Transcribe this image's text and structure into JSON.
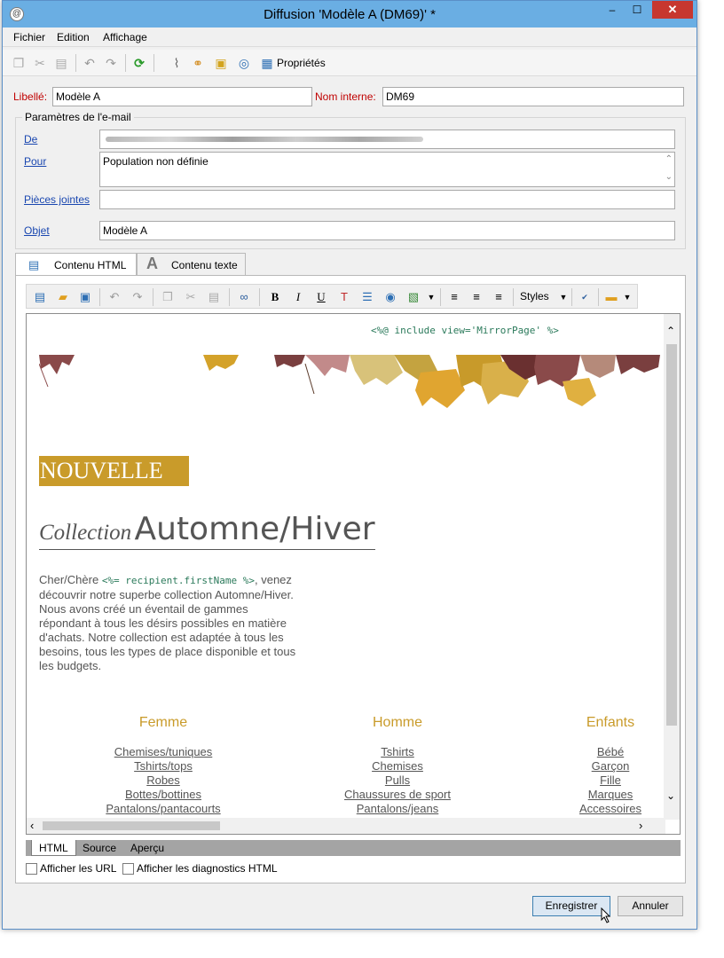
{
  "window": {
    "title": "Diffusion 'Modèle A (DM69)' *",
    "minimize": "–",
    "maximize": "☐",
    "close": "✕"
  },
  "menu": {
    "items": [
      "Fichier",
      "Edition",
      "Affichage"
    ]
  },
  "toolbar": {
    "properties_label": "Propriétés"
  },
  "form": {
    "label_label": "Libellé:",
    "label_value": "Modèle A",
    "internal_name_label": "Nom interne:",
    "internal_name_value": "DM69"
  },
  "email_params": {
    "group_title": "Paramètres de l'e-mail",
    "from_label": "De",
    "to_label": "Pour",
    "to_value": "Population non définie",
    "attachments_label": "Pièces jointes",
    "attachments_value": "",
    "subject_label": "Objet",
    "subject_value": "Modèle A"
  },
  "tabs": {
    "html": "Contenu HTML",
    "text": "Contenu texte"
  },
  "editor_toolbar": {
    "bold": "B",
    "italic": "I",
    "underline": "U",
    "styles": "Styles"
  },
  "content": {
    "include": "<%@ include view='MirrorPage' %>",
    "nouvelle": "NOUVELLE",
    "collection_a": "Collection",
    "collection_b": "Automne/Hiver",
    "greeting": "Cher/Chère ",
    "first_name_var": "<%= recipient.firstName %>",
    "body_after_var": ", venez découvrir notre superbe collection Automne/Hiver.",
    "body_2": "Nous avons créé un éventail de gammes répondant à tous les désirs possibles en matière d'achats. Notre collection est adaptée à tous les besoins, tous les types de place disponible et tous les budgets.",
    "columns": [
      {
        "title": "Femme",
        "items": [
          "Chemises/tuniques",
          "Tshirts/tops",
          "Robes",
          "Bottes/bottines",
          "Pantalons/pantacourts"
        ]
      },
      {
        "title": "Homme",
        "items": [
          "Tshirts",
          "Chemises",
          "Pulls",
          "Chaussures de sport",
          "Pantalons/jeans"
        ]
      },
      {
        "title": "Enfants",
        "items": [
          "Bébé",
          "Garçon",
          "Fille",
          "Marques",
          "Accessoires"
        ]
      }
    ]
  },
  "view_tabs": [
    "HTML",
    "Source",
    "Aperçu"
  ],
  "options": {
    "show_urls": "Afficher les URL",
    "show_diag": "Afficher les diagnostics HTML"
  },
  "buttons": {
    "save": "Enregistrer",
    "cancel": "Annuler"
  },
  "colors": {
    "accent": "#c99b2a",
    "title_bar": "#6aaee3",
    "close": "#c7372f"
  }
}
